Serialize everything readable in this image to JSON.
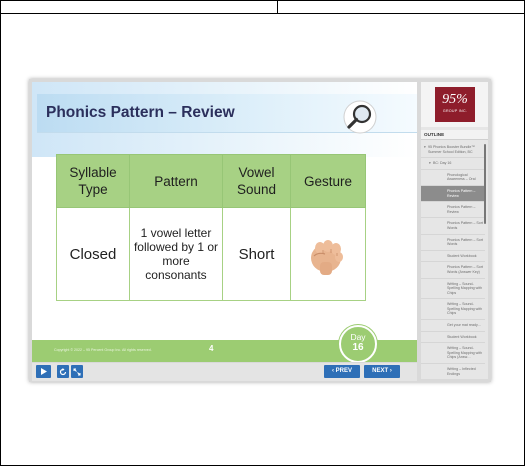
{
  "slide": {
    "title": "Phonics Pattern – Review",
    "table": {
      "headers": [
        "Syllable Type",
        "Pattern",
        "Vowel Sound",
        "Gesture"
      ],
      "row": {
        "syllable_type": "Closed",
        "pattern": "1 vowel letter followed by 1 or more consonants",
        "vowel_sound": "Short",
        "gesture_icon": "closed-fist-icon"
      }
    },
    "footer": {
      "copyright": "Copyright © 2022 – 95 Percent Group Inc. All rights reserved.",
      "page_number": "4"
    },
    "day_badge": {
      "label": "Day",
      "number": "16"
    }
  },
  "controls": {
    "play_icon": "play-icon",
    "replay_icon": "replay-icon",
    "fullscreen_icon": "fullscreen-icon",
    "prev_label": "‹ PREV",
    "next_label": "NEXT ›"
  },
  "sidebar": {
    "logo": {
      "main": "95%",
      "sub": "GROUP INC."
    },
    "outline_label": "OUTLINE",
    "items": [
      {
        "label": "95 Phonics Booster Bundle™ Summer School Edition, BC",
        "level": 0,
        "caret": "▾"
      },
      {
        "label": "BC: Day 16",
        "level": 1,
        "caret": "▾"
      },
      {
        "label": "Phonological Awareness – Oral",
        "level": 2
      },
      {
        "label": "Phonics Pattern – Review",
        "level": 2,
        "active": true
      },
      {
        "label": "Phonics Pattern – Review",
        "level": 2
      },
      {
        "label": "Phonics Pattern – Sort Words",
        "level": 2
      },
      {
        "label": "Phonics Pattern – Sort Words",
        "level": 2
      },
      {
        "label": "Student Workbook",
        "level": 2
      },
      {
        "label": "Phonics Pattern – Sort Words (Answer Key)",
        "level": 2
      },
      {
        "label": "Writing – Sound-Spelling Mapping with Chips",
        "level": 2
      },
      {
        "label": "Writing – Sound-Spelling Mapping with Chips",
        "level": 2
      },
      {
        "label": "Get your mat ready…",
        "level": 2
      },
      {
        "label": "Student Workbook",
        "level": 2
      },
      {
        "label": "Writing – Sound-Spelling Mapping with Chips (Answ…",
        "level": 2
      },
      {
        "label": "Writing – Inflected Endings",
        "level": 2
      }
    ]
  },
  "colors": {
    "table_green": "#a7d184",
    "footer_green": "#9ccc72",
    "title_navy": "#2b2f5c",
    "nav_blue": "#2e6fb7",
    "logo_maroon": "#8e1d2b"
  }
}
